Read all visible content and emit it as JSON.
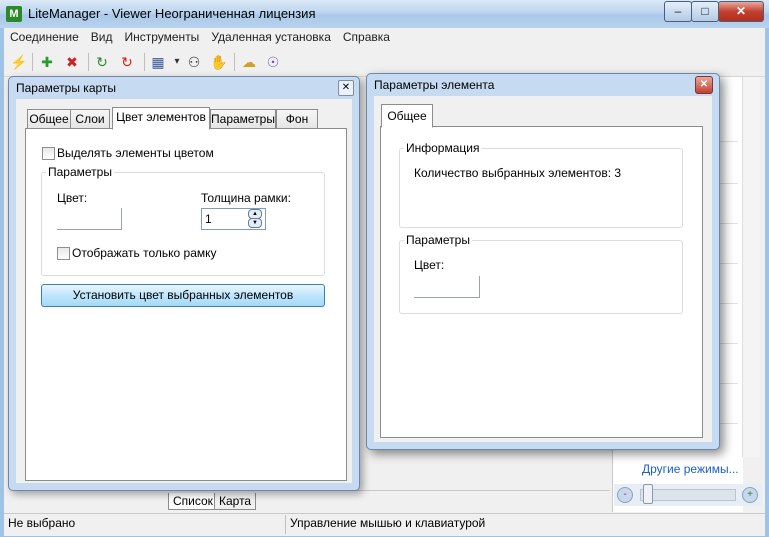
{
  "window": {
    "app_icon": "M",
    "title": "LiteManager - Viewer   Неограниченная лицензия",
    "controls": {
      "minimize": "–",
      "maximize": "□",
      "close": "✕"
    }
  },
  "menu": {
    "items": [
      "Соединение",
      "Вид",
      "Инструменты",
      "Удаленная установка",
      "Справка"
    ]
  },
  "toolbar": {
    "icons": [
      "lightning-icon",
      "add-icon",
      "delete-icon",
      "refresh-icon",
      "refresh-red-icon",
      "view-grid-icon",
      "dropdown-icon",
      "binoculars-icon",
      "hand-icon",
      "chat-icon",
      "network-icon"
    ],
    "glyphs": [
      "⚡",
      "✚",
      "✖",
      "↻",
      "↻",
      "▦",
      "▾",
      "⚇",
      "✋",
      "☁",
      "☉"
    ]
  },
  "map_dialog": {
    "title": "Параметры карты",
    "close": "✕",
    "tabs": [
      "Общее",
      "Слои",
      "Цвет элементов",
      "Параметры",
      "Фон"
    ],
    "active_tab": "Цвет элементов",
    "highlight_checkbox": "Выделять элементы цветом",
    "params_group": "Параметры",
    "color_label": "Цвет:",
    "frame_width_label": "Толщина рамки:",
    "frame_width_value": "1",
    "frame_only_checkbox": "Отображать только рамку",
    "apply_button": "Установить цвет выбранных элементов"
  },
  "element_dialog": {
    "title": "Параметры элемента",
    "close": "✕",
    "tab": "Общее",
    "info_group": "Информация",
    "selected_count_text": "Количество выбранных элементов: 3",
    "params_group": "Параметры",
    "color_label": "Цвет:"
  },
  "background": {
    "other_modes_link": "Другие режимы...",
    "bottom_tabs": [
      "Список",
      "Карта"
    ],
    "zoom_minus": "-",
    "zoom_plus": "+"
  },
  "status": {
    "left": "Не выбрано",
    "right": "Управление мышью и клавиатурой"
  },
  "colors": {
    "title_gradient_top": "#dbe9f7",
    "dialog_frame": "#c6daf1",
    "apply_button": "#bee6fd",
    "close_red": "#c2402f",
    "link_blue": "#1a5fc1"
  }
}
